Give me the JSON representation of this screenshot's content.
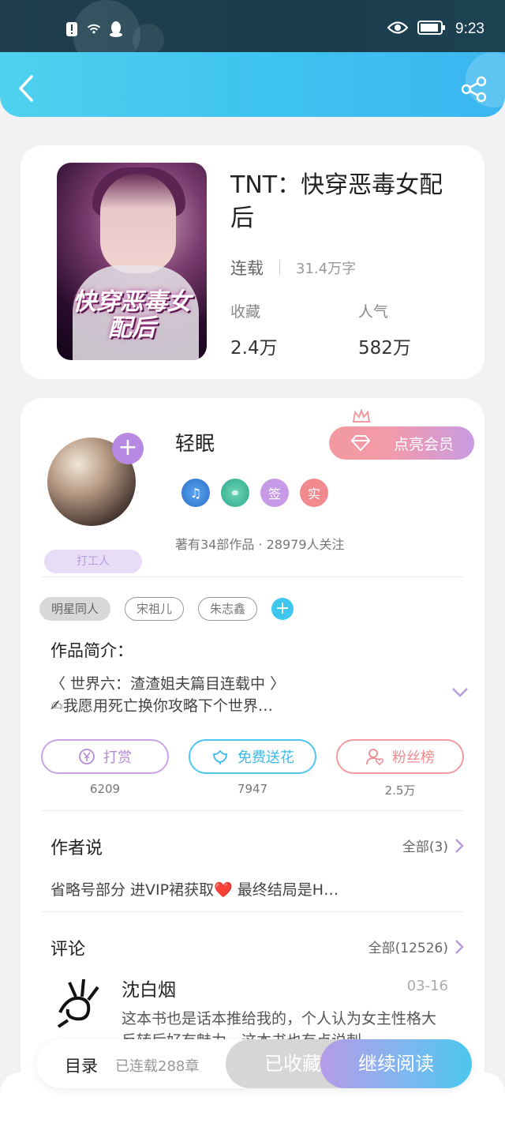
{
  "status_bar": {
    "time": "9:23"
  },
  "book": {
    "title": "TNT：快穿恶毒女配后",
    "cover_title": "快穿恶毒女配后",
    "status": "连载",
    "word_count": "31.4万字",
    "collect_label": "收藏",
    "collect_value": "2.4万",
    "popularity_label": "人气",
    "popularity_value": "582万"
  },
  "author": {
    "name": "轻眠",
    "vip_button": "点亮会员",
    "badge": "打工人",
    "medals": [
      "♫",
      "⚭",
      "签",
      "实"
    ],
    "stats": "著有34部作品 · 28979人关注"
  },
  "tags": {
    "items": [
      "明星同人",
      "宋祖儿",
      "朱志鑫"
    ],
    "add": "+"
  },
  "intro": {
    "title": "作品简介：",
    "line1": "〈 世界六：渣渣姐夫篇目连载中 〉",
    "line2": "✍我愿用死亡换你攻略下个世界…"
  },
  "actions": {
    "reward_label": "打赏",
    "reward_count": "6209",
    "flower_label": "免费送花",
    "flower_count": "7947",
    "fans_label": "粉丝榜",
    "fans_count": "2.5万"
  },
  "author_says": {
    "title": "作者说",
    "more": "全部(3)",
    "text": "省略号部分 进VIP裙获取❤️ 最终结局是H…"
  },
  "comments": {
    "title": "评论",
    "more": "全部(12526)",
    "items": [
      {
        "name": "沈白烟",
        "date": "03-16",
        "text": "这本书也是话本推给我的，个人认为女主性格大反转后好有魅力，这本书也有点说刺"
      }
    ]
  },
  "bottom_bar": {
    "toc": "目录",
    "chapters": "已连载288章",
    "favorited": "已收藏",
    "continue": "继续阅读"
  },
  "colors": {
    "header_start": "#4fd1ef",
    "header_end": "#3bb6f0",
    "vip_gradient": "#f29a9f",
    "reward": "#c9a3e6",
    "flower": "#4cc7ee",
    "fans": "#f29a9f"
  }
}
